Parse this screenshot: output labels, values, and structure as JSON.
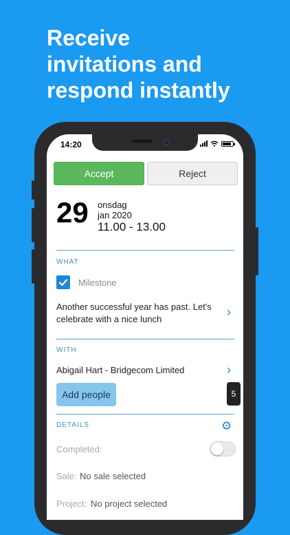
{
  "headline": [
    "Receive",
    "invitations and",
    "respond instantly"
  ],
  "status_bar": {
    "time": "14:20"
  },
  "actions": {
    "accept": "Accept",
    "reject": "Reject"
  },
  "event": {
    "day": "29",
    "weekday": "onsdag",
    "month_year": "jan 2020",
    "time_range": "11.00 - 13.00"
  },
  "what": {
    "label": "WHAT",
    "milestone_label": "Milestone",
    "milestone_checked": true,
    "description": "Another successful year has past. Let's celebrate with a nice lunch"
  },
  "with": {
    "label": "WITH",
    "participant": "Abigail Hart - Bridgecom Limited",
    "add_people": "Add people",
    "count": "5"
  },
  "details": {
    "label": "DETAILS",
    "completed_label": "Completed:",
    "completed": false,
    "sale_label": "Sale:",
    "sale_value": "No sale selected",
    "project_label": "Project:",
    "project_value": "No project selected"
  },
  "colors": {
    "background": "#1a9af0",
    "accept": "#5cb85c",
    "accent": "#2f86c4",
    "add_people": "#86c5ec"
  }
}
